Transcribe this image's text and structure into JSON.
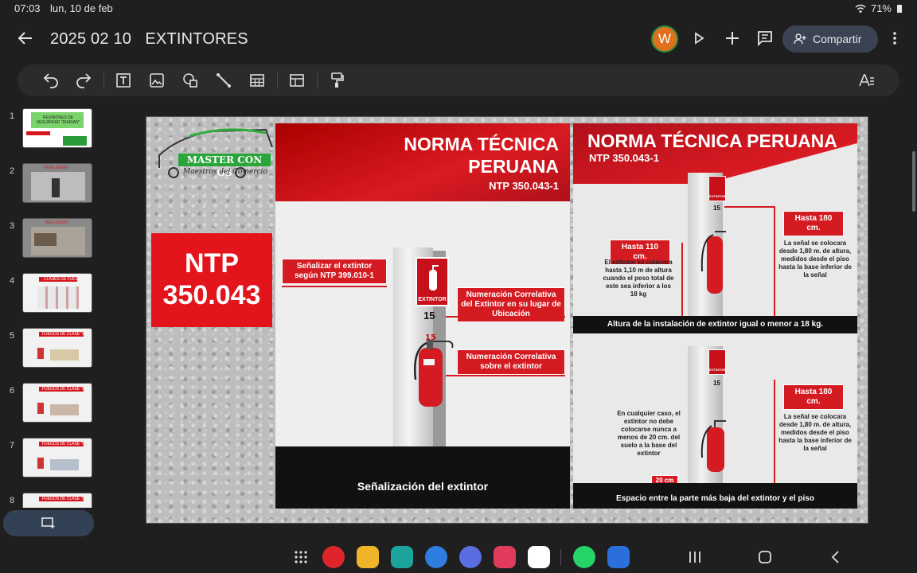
{
  "status": {
    "time": "07:03",
    "date": "lun, 10 de feb",
    "battery": "71%"
  },
  "header": {
    "title": "2025 02 10   EXTINTORES",
    "avatar_letter": "W",
    "share_label": "Compartir"
  },
  "thumbnails": [
    {
      "num": "1",
      "line1": "REUNIONES DE",
      "line2": "SEGURIDAD \"DIARIAS\""
    },
    {
      "num": "2",
      "line1": "\"REFLEXIÓN\""
    },
    {
      "num": "3",
      "line1": "\"REFLEXIÓN\""
    },
    {
      "num": "4",
      "line1": "CLASES DE FUEGO"
    },
    {
      "num": "5",
      "line1": "FUEGOS DE CLASE \"A\""
    },
    {
      "num": "6",
      "line1": "FUEGOS DE CLASE \"B\""
    },
    {
      "num": "7",
      "line1": "FUEGOS DE CLASE \"C\""
    },
    {
      "num": "8",
      "line1": "FUEGOS DE CLASE \"D\""
    }
  ],
  "slide": {
    "logo_text": "MASTER CON GS",
    "logo_sub": "Maestros del Comercio",
    "ntp_line1": "NTP",
    "ntp_line2": "350.043",
    "middle": {
      "head1": "NORMA TÉCNICA",
      "head2": "PERUANA",
      "head3": "NTP 350.043-1",
      "tag1": "Señalizar el extintor según NTP 399.010-1",
      "tag2": "Numeración Correlativa del Extintor en su lugar de Ubicación",
      "tag3": "Numeración Correlativa sobre el extintor",
      "sign_label": "EXTINTOR",
      "number": "15",
      "footer": "Señalización del extintor"
    },
    "right": {
      "head1": "NORMA TÉCNICA PERUANA",
      "head2": "NTP 350.043-1",
      "top": {
        "tag_left": "Hasta 110 cm.",
        "text_left": "El extintor se colocara hasta 1,10 m de altura cuando el peso total de este sea inferior a los 18 kg",
        "tag_right": "Hasta 180 cm.",
        "text_right": "La señal se colocara desde 1,80 m. de altura, medidos desde el piso hasta la base inferior de la señal",
        "sign_label": "EXTINTOR",
        "number": "15",
        "footer": "Altura de la instalación de extintor igual o menor a 18 kg."
      },
      "bottom": {
        "text_left": "En cualquier caso, el extintor no debe colocarse nunca a menos de 20 cm. del suelo a la base del extintor",
        "tag_right": "Hasta 180 cm.",
        "text_right": "La señal se colocara desde 1,80 m. de altura, medidos desde el piso hasta la base inferior de la señal",
        "tag_floor": "20 cm",
        "sign_label": "EXTINTOR",
        "number": "15",
        "footer": "Espacio entre la parte más baja del extintor y el piso"
      }
    }
  },
  "colors": {
    "accent_red": "#c8101a",
    "share_bg": "#3b4353",
    "avatar": "#e0711c"
  }
}
